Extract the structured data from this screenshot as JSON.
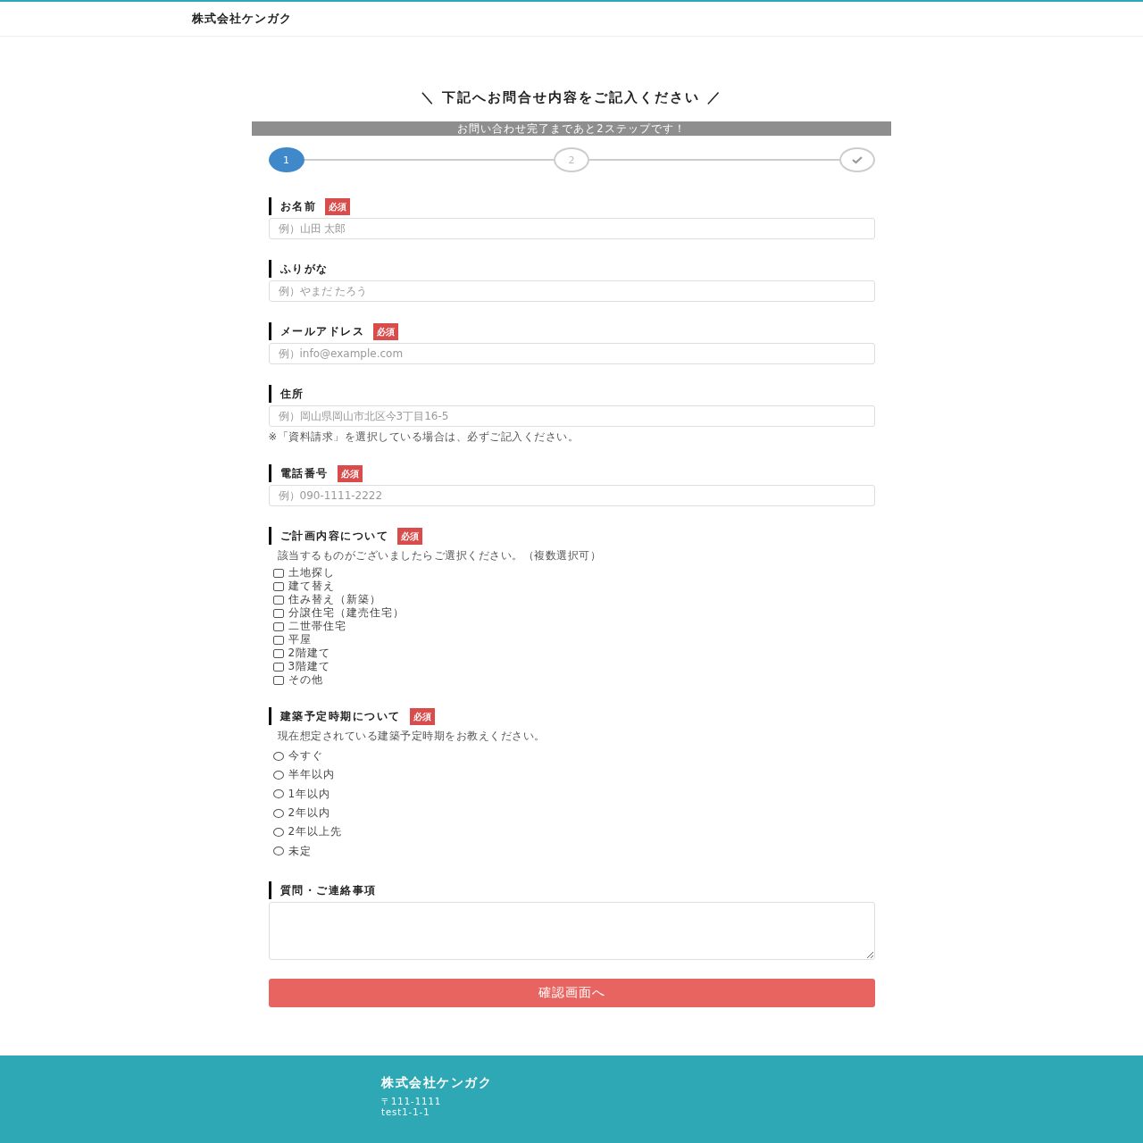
{
  "header": {
    "brand": "株式会社ケンガク"
  },
  "heading": "＼ 下記へお問合せ内容をご記入ください ／",
  "progress_banner": "お問い合わせ完了まであと2ステップです！",
  "steps": [
    {
      "kind": "number",
      "label": "1",
      "selected": true
    },
    {
      "kind": "number",
      "label": "2",
      "selected": false
    },
    {
      "kind": "check",
      "selected": false
    }
  ],
  "fields": [
    {
      "kind": "text",
      "label": "お名前",
      "badge": "必須",
      "placeholder": "例）山田 太郎"
    },
    {
      "kind": "text",
      "label": "ふりがな",
      "placeholder": "例）やまだ たろう"
    },
    {
      "kind": "text",
      "label": "メールアドレス",
      "badge": "必須",
      "placeholder": "例）info@example.com"
    },
    {
      "kind": "text",
      "label": "住所",
      "placeholder": "例）岡山県岡山市北区今3丁目16-5",
      "note": "※「資料請求」を選択している場合は、必ずご記入ください。"
    },
    {
      "kind": "text",
      "label": "電話番号",
      "badge": "必須",
      "placeholder": "例）090-1111-2222"
    },
    {
      "kind": "checkboxes",
      "label": "ご計画内容について",
      "badge": "必須",
      "hint": "該当するものがございましたらご選択ください。（複数選択可）",
      "options": [
        {
          "label": "土地探し",
          "checked": false
        },
        {
          "label": "建て替え",
          "checked": false
        },
        {
          "label": "住み替え（新築）",
          "checked": false
        },
        {
          "label": "分譲住宅（建売住宅）",
          "checked": false
        },
        {
          "label": "二世帯住宅",
          "checked": false
        },
        {
          "label": "平屋",
          "checked": false
        },
        {
          "label": "2階建て",
          "checked": false
        },
        {
          "label": "3階建て",
          "checked": false
        },
        {
          "label": "その他",
          "checked": false
        }
      ]
    },
    {
      "kind": "radios",
      "label": "建築予定時期について",
      "badge": "必須",
      "hint": "現在想定されている建築予定時期をお教えください。",
      "options": [
        {
          "label": "今すぐ",
          "selected": false
        },
        {
          "label": "半年以内",
          "selected": false
        },
        {
          "label": "1年以内",
          "selected": false
        },
        {
          "label": "2年以内",
          "selected": false
        },
        {
          "label": "2年以上先",
          "selected": false
        },
        {
          "label": "未定",
          "selected": false
        }
      ]
    },
    {
      "kind": "textarea",
      "label": "質問・ご連絡事項"
    }
  ],
  "submit_button": "確認画面へ",
  "footer": {
    "company": "株式会社ケンガク",
    "postal": "〒111-1111",
    "address": "test1-1-1"
  }
}
